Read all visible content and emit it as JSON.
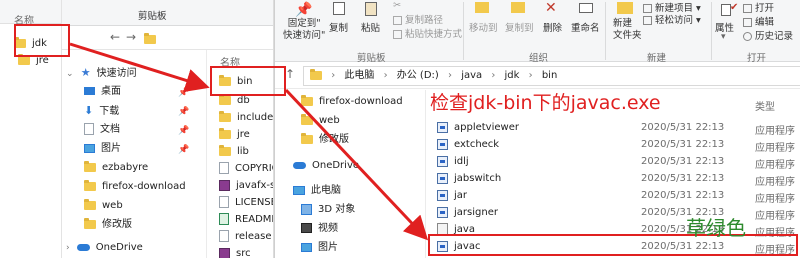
{
  "colors": {
    "accent": "#e02020",
    "folder": "#f2c94c",
    "annotation": "#e02020",
    "green": "#2d8a2d"
  },
  "win1": {
    "header_name": "名称",
    "tree": [
      {
        "label": "jdk"
      },
      {
        "label": "jre"
      }
    ]
  },
  "win2": {
    "ribbon": {
      "clipboard_label": "剪贴板"
    },
    "back_label": "←",
    "forward_label": "→",
    "header_name": "名称",
    "quick_access_label": "快速访问",
    "nav_items": [
      {
        "label": "桌面",
        "icon": "desktop-icon"
      },
      {
        "label": "下载",
        "icon": "download-icon"
      },
      {
        "label": "文档",
        "icon": "document-icon"
      },
      {
        "label": "图片",
        "icon": "picture-icon"
      },
      {
        "label": "ezbabyre",
        "icon": "folder-icon"
      },
      {
        "label": "firefox-download",
        "icon": "folder-icon"
      },
      {
        "label": "web",
        "icon": "folder-icon"
      },
      {
        "label": "修改版",
        "icon": "folder-icon"
      }
    ],
    "onedrive_label": "OneDrive",
    "files": [
      {
        "label": "bin"
      },
      {
        "label": "db"
      },
      {
        "label": "include"
      },
      {
        "label": "jre"
      },
      {
        "label": "lib"
      },
      {
        "label": "COPYRIG"
      },
      {
        "label": "javafx-src"
      },
      {
        "label": "LICENSE"
      },
      {
        "label": "README"
      },
      {
        "label": "release"
      },
      {
        "label": "src"
      }
    ]
  },
  "win3": {
    "ribbon": {
      "pin_quick": "固定到\"\n快速访问\"",
      "copy": "复制",
      "paste": "粘贴",
      "cut": "✂",
      "copy_path": "复制路径",
      "paste_shortcut": "粘贴快捷方式",
      "move_to": "移动到",
      "copy_to": "复制到",
      "delete": "删除",
      "rename": "重命名",
      "new_folder": "新建\n文件夹",
      "new_item": "新建项目",
      "easy_access": "轻松访问",
      "properties": "属性",
      "open": "打开",
      "edit": "编辑",
      "history": "历史记录",
      "group_clipboard": "剪贴板",
      "group_organize": "组织",
      "group_new": "新建",
      "group_open": "打开"
    },
    "breadcrumb": [
      "此电脑",
      "办公 (D:)",
      "java",
      "jdk",
      "bin"
    ],
    "col_type": "类型",
    "nav_items": [
      {
        "label": "firefox-download"
      },
      {
        "label": "web"
      },
      {
        "label": "修改版"
      }
    ],
    "onedrive_label": "OneDrive",
    "thispc_label": "此电脑",
    "thispc_items": [
      {
        "label": "3D 对象"
      },
      {
        "label": "视频"
      },
      {
        "label": "图片"
      }
    ],
    "files": [
      {
        "name": "appletviewer",
        "date": "2020/5/31 22:13",
        "type": "应用程序"
      },
      {
        "name": "extcheck",
        "date": "2020/5/31 22:13",
        "type": "应用程序"
      },
      {
        "name": "idlj",
        "date": "2020/5/31 22:13",
        "type": "应用程序"
      },
      {
        "name": "jabswitch",
        "date": "2020/5/31 22:13",
        "type": "应用程序"
      },
      {
        "name": "jar",
        "date": "2020/5/31 22:13",
        "type": "应用程序"
      },
      {
        "name": "jarsigner",
        "date": "2020/5/31 22:13",
        "type": "应用程序"
      },
      {
        "name": "java",
        "date": "2020/5/31 22:13",
        "type": "应用程序"
      },
      {
        "name": "javac",
        "date": "2020/5/31 22:13",
        "type": "应用程序"
      }
    ]
  },
  "annotations": {
    "heading": "检查jdk-bin下的javac.exe",
    "stamp": "草绿色"
  }
}
